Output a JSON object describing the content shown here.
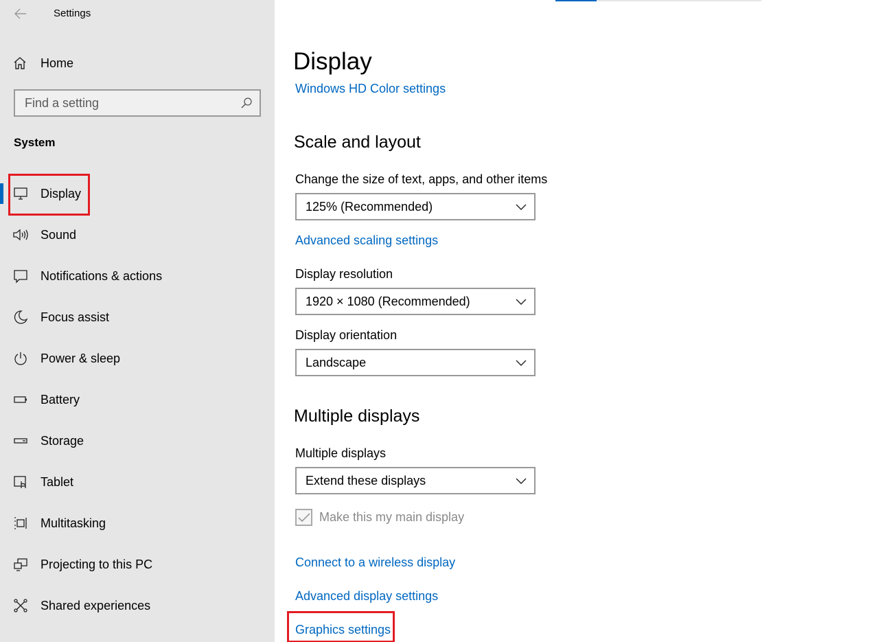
{
  "window": {
    "title": "Settings"
  },
  "sidebar": {
    "home_label": "Home",
    "search_placeholder": "Find a setting",
    "section_title": "System",
    "items": [
      {
        "label": "Display",
        "icon": "monitor-icon",
        "active": true
      },
      {
        "label": "Sound",
        "icon": "speaker-icon"
      },
      {
        "label": "Notifications & actions",
        "icon": "notification-icon"
      },
      {
        "label": "Focus assist",
        "icon": "moon-icon"
      },
      {
        "label": "Power & sleep",
        "icon": "power-icon"
      },
      {
        "label": "Battery",
        "icon": "battery-icon"
      },
      {
        "label": "Storage",
        "icon": "storage-icon"
      },
      {
        "label": "Tablet",
        "icon": "tablet-icon"
      },
      {
        "label": "Multitasking",
        "icon": "multitasking-icon"
      },
      {
        "label": "Projecting to this PC",
        "icon": "projecting-icon"
      },
      {
        "label": "Shared experiences",
        "icon": "shared-icon"
      }
    ]
  },
  "main": {
    "title": "Display",
    "hd_color_link": "Windows HD Color settings",
    "scale_section": {
      "heading": "Scale and layout",
      "scale_label": "Change the size of text, apps, and other items",
      "scale_value": "125% (Recommended)",
      "advanced_scaling_link": "Advanced scaling settings",
      "resolution_label": "Display resolution",
      "resolution_value": "1920 × 1080 (Recommended)",
      "orientation_label": "Display orientation",
      "orientation_value": "Landscape"
    },
    "multiple_section": {
      "heading": "Multiple displays",
      "label": "Multiple displays",
      "value": "Extend these displays",
      "main_display_checkbox": "Make this my main display",
      "wireless_link": "Connect to a wireless display",
      "advanced_display_link": "Advanced display settings",
      "graphics_link": "Graphics settings"
    }
  },
  "colors": {
    "accent": "#0067c0",
    "sidebar_bg": "#e6e6e6",
    "highlight": "#e31c23"
  }
}
